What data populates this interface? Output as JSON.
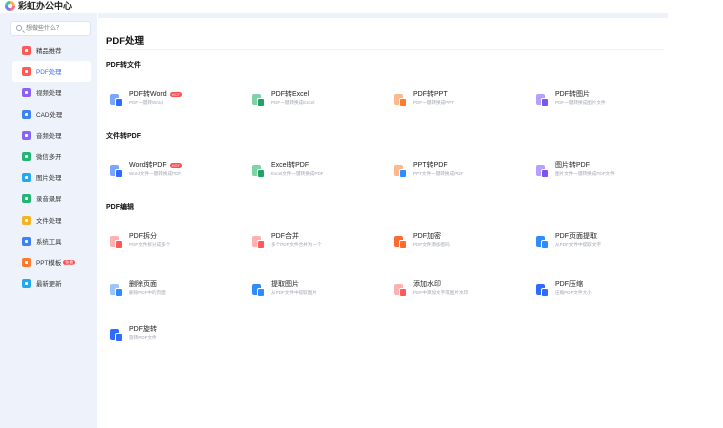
{
  "app": {
    "title": "彩虹办公中心"
  },
  "search": {
    "placeholder": "想做些什么？"
  },
  "sidebar": {
    "items": [
      {
        "label": "精品推荐",
        "color": "#ff5a5a",
        "icon": "gift-icon"
      },
      {
        "label": "PDF处理",
        "color": "#ff5a5a",
        "icon": "pdf-icon",
        "active": true
      },
      {
        "label": "视频处理",
        "color": "#8a63f5",
        "icon": "video-icon"
      },
      {
        "label": "CAD处理",
        "color": "#3b82f6",
        "icon": "cad-icon"
      },
      {
        "label": "音频处理",
        "color": "#8a63f5",
        "icon": "audio-icon"
      },
      {
        "label": "微信多开",
        "color": "#22b573",
        "icon": "wechat-icon"
      },
      {
        "label": "图片处理",
        "color": "#22a8f0",
        "icon": "image-icon"
      },
      {
        "label": "录音录屏",
        "color": "#22b573",
        "icon": "record-icon"
      },
      {
        "label": "文件处理",
        "color": "#f5b323",
        "icon": "folder-icon"
      },
      {
        "label": "系统工具",
        "color": "#3b82f6",
        "icon": "tools-icon"
      },
      {
        "label": "PPT模板",
        "color": "#ff7a2f",
        "icon": "ppt-icon",
        "badge": "免费"
      },
      {
        "label": "最新更新",
        "color": "#22a8f0",
        "icon": "update-icon"
      }
    ]
  },
  "main": {
    "title": "PDF处理",
    "sections": [
      {
        "title": "PDF转文件",
        "cards": [
          {
            "title": "PDF转Word",
            "desc": "PDF一键转Word",
            "badge": "HOT",
            "color": "#2f6bff",
            "color2": "#7aa6ff",
            "icon": "pdf-to-word-icon"
          },
          {
            "title": "PDF转Excel",
            "desc": "PDF一键转换成Excel",
            "color": "#1fa463",
            "color2": "#7fd3a6",
            "icon": "pdf-to-excel-icon"
          },
          {
            "title": "PDF转PPT",
            "desc": "PDF一键转换成PPT",
            "color": "#ff7a2f",
            "color2": "#ffb88a",
            "icon": "pdf-to-ppt-icon"
          },
          {
            "title": "PDF转图片",
            "desc": "PDF一键转换成图片文件",
            "color": "#7a55f0",
            "color2": "#b6a0ff",
            "icon": "pdf-to-image-icon"
          }
        ]
      },
      {
        "title": "文件转PDF",
        "cards": [
          {
            "title": "Word转PDF",
            "desc": "Word文件一键转换成PDF",
            "badge": "HOT",
            "color": "#2f6bff",
            "color2": "#7aa6ff",
            "icon": "word-to-pdf-icon"
          },
          {
            "title": "Excel转PDF",
            "desc": "Excel文件一键转换成PDF",
            "color": "#1fa463",
            "color2": "#7fd3a6",
            "icon": "excel-to-pdf-icon"
          },
          {
            "title": "PPT转PDF",
            "desc": "PPT文件一键转换成PDF",
            "color": "#2f8cff",
            "color2": "#ffb88a",
            "icon": "ppt-to-pdf-icon"
          },
          {
            "title": "图片转PDF",
            "desc": "图片文件一键转换成PDF文件",
            "color": "#7a55f0",
            "color2": "#b6a0ff",
            "icon": "image-to-pdf-icon"
          }
        ]
      },
      {
        "title": "PDF编辑",
        "cards": [
          {
            "title": "PDF拆分",
            "desc": "PDF文件拆分成多个",
            "color": "#ff5a5a",
            "color2": "#ffb0b0",
            "icon": "pdf-split-icon"
          },
          {
            "title": "PDF合并",
            "desc": "多个PDF文件合并为一个",
            "color": "#ff5a5a",
            "color2": "#ffb0b0",
            "icon": "pdf-merge-icon"
          },
          {
            "title": "PDF加密",
            "desc": "PDF文件添加密码",
            "color": "#ff6a2f",
            "color2": "#ff6a2f",
            "icon": "pdf-encrypt-icon"
          },
          {
            "title": "PDF页面提取",
            "desc": "从PDF文件中提取文字",
            "color": "#2f8cff",
            "color2": "#2f8cff",
            "icon": "pdf-extract-page-icon"
          },
          {
            "title": "删除页面",
            "desc": "删除PDF中的页面",
            "color": "#2f8cff",
            "color2": "#9cc4ff",
            "icon": "delete-page-icon"
          },
          {
            "title": "提取图片",
            "desc": "从PDF文件中提取图片",
            "color": "#2f8cff",
            "color2": "#2f8cff",
            "icon": "extract-image-icon"
          },
          {
            "title": "添加水印",
            "desc": "PDF中添加文字或图片水印",
            "color": "#ff5a5a",
            "color2": "#ffb0b0",
            "icon": "add-watermark-icon"
          },
          {
            "title": "PDF压缩",
            "desc": "压缩PDF文件大小",
            "color": "#2f6bff",
            "color2": "#2f6bff",
            "icon": "pdf-compress-icon"
          },
          {
            "title": "PDF旋转",
            "desc": "旋转PDF文件",
            "color": "#2f6bff",
            "color2": "#2f6bff",
            "icon": "pdf-rotate-icon"
          }
        ]
      }
    ]
  }
}
